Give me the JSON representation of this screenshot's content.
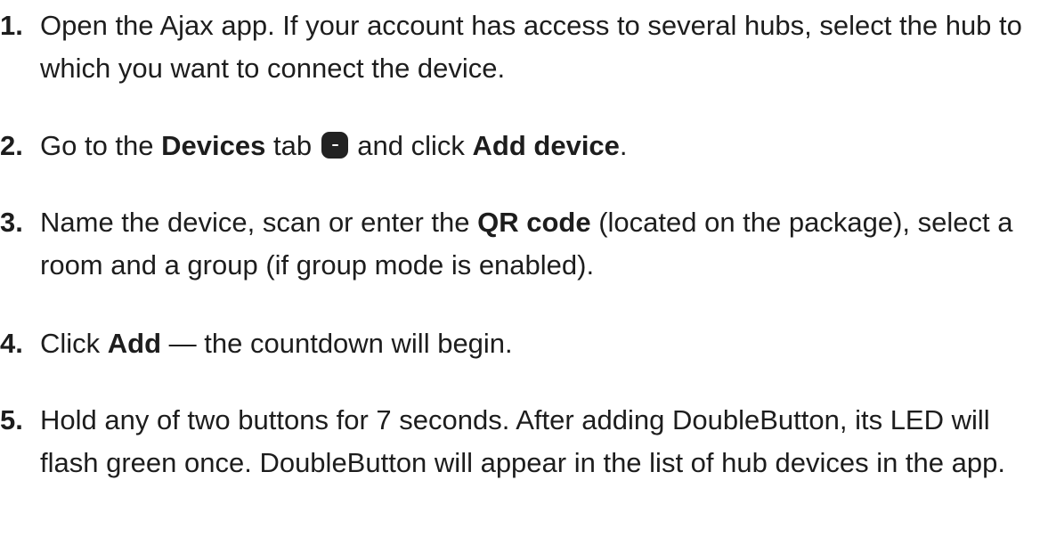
{
  "steps": [
    {
      "number": "1.",
      "text": "Open the Ajax app. If your account has access to several hubs, select the hub to which you want to connect the device."
    },
    {
      "number": "2.",
      "pre": "Go to the ",
      "bold1": "Devices",
      "mid": " tab ",
      "icon": "devices-tab-icon",
      "mid2": " and click ",
      "bold2": "Add device",
      "post": "."
    },
    {
      "number": "3.",
      "pre": "Name the device, scan or enter the ",
      "bold1": "QR code",
      "post": " (located on the package), select a room and a group (if group mode is enabled)."
    },
    {
      "number": "4.",
      "pre": "Click ",
      "bold1": "Add",
      "post": " — the countdown will begin."
    },
    {
      "number": "5.",
      "text": "Hold any of two buttons for 7 seconds. After adding DoubleButton, its LED will flash green once. DoubleButton will appear in the list of hub devices in the app."
    }
  ]
}
